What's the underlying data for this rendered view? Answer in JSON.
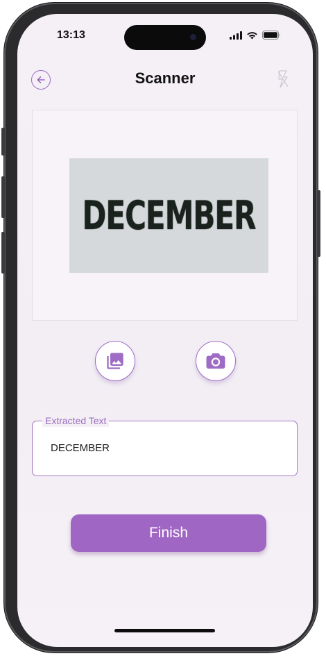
{
  "status_bar": {
    "time": "13:13",
    "icons": [
      "cellular-signal-icon",
      "wifi-icon",
      "battery-icon"
    ]
  },
  "header": {
    "title": "Scanner",
    "back_icon": "arrow-left-icon",
    "flash_icon": "flash-off-icon"
  },
  "preview": {
    "image_text": "DECEMBER"
  },
  "actions": {
    "gallery_icon": "photo-library-icon",
    "camera_icon": "camera-icon"
  },
  "extracted": {
    "label": "Extracted Text",
    "value": "DECEMBER"
  },
  "finish": {
    "label": "Finish"
  },
  "colors": {
    "accent": "#a066c3",
    "background": "#f4eff5",
    "text": "#121212"
  }
}
